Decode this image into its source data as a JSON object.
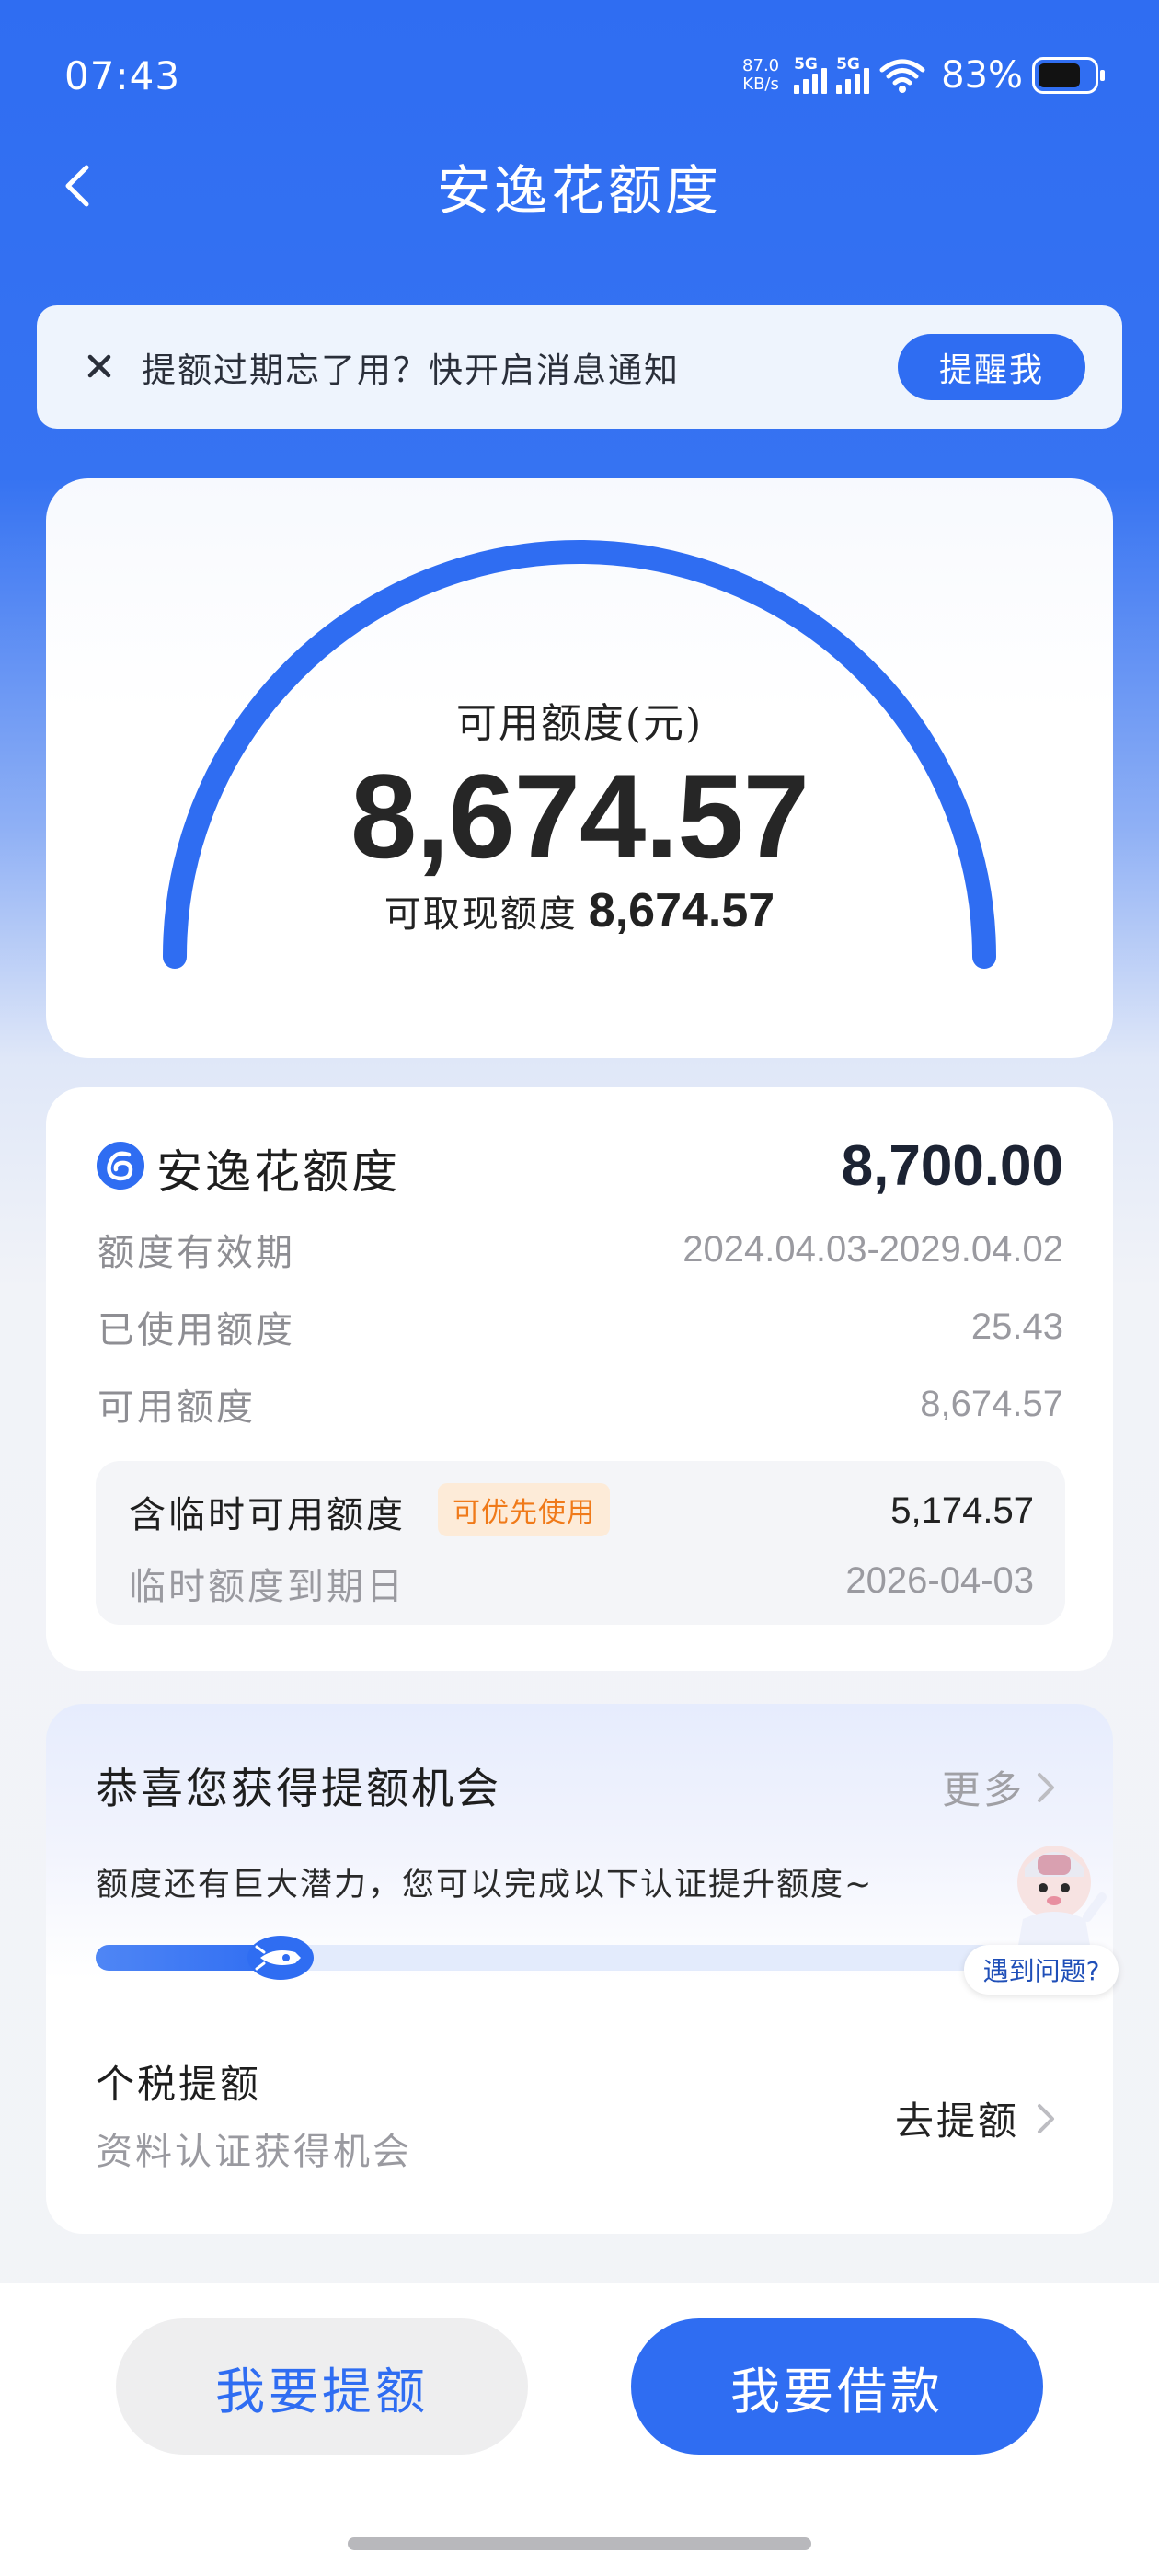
{
  "status_bar": {
    "time": "07:43",
    "net_speed_value": "87.0",
    "net_speed_unit": "KB/s",
    "signal_1_label": "5G",
    "signal_2_label": "5G",
    "battery_percent": "83%",
    "battery_level": 0.83
  },
  "header": {
    "title": "安逸花额度"
  },
  "notice": {
    "text": "提额过期忘了用？快开启消息通知",
    "button_label": "提醒我"
  },
  "gauge": {
    "label": "可用额度(元)",
    "value": "8,674.57",
    "sub_label": "可取现额度",
    "sub_value": "8,674.57",
    "accent_color": "#2f6df2"
  },
  "limit_card": {
    "title": "安逸花额度",
    "total": "8,700.00",
    "rows": [
      {
        "label": "额度有效期",
        "value": "2024.04.03-2029.04.02"
      },
      {
        "label": "已使用额度",
        "value": "25.43"
      },
      {
        "label": "可用额度",
        "value": "8,674.57"
      }
    ],
    "temp": {
      "label": "含临时可用额度",
      "badge": "可优先使用",
      "value": "5,174.57",
      "expiry_label": "临时额度到期日",
      "expiry_value": "2026-04-03"
    }
  },
  "opportunity": {
    "title": "恭喜您获得提额机会",
    "more_label": "更多",
    "description": "额度还有巨大潜力，您可以完成以下认证提升额度~",
    "progress": 0.19,
    "task_title": "个税提额",
    "task_subtitle": "资料认证获得机会",
    "task_action": "去提额"
  },
  "help": {
    "label": "遇到问题?"
  },
  "bottom": {
    "raise_label": "我要提额",
    "borrow_label": "我要借款"
  },
  "colors": {
    "brand_blue": "#2f6df2",
    "badge_orange": "#f07a1a"
  }
}
